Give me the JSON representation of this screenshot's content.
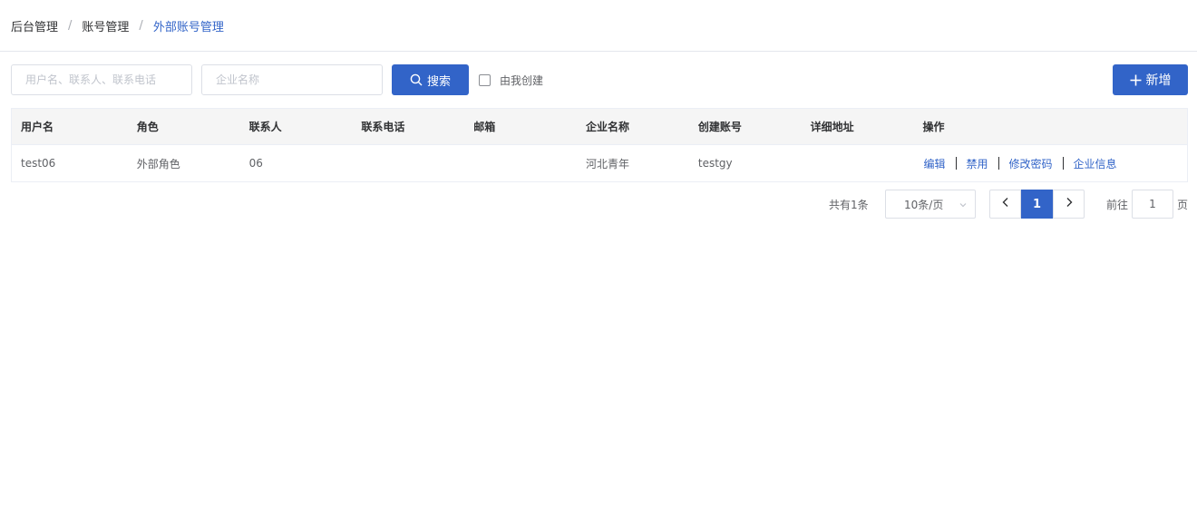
{
  "breadcrumb": {
    "items": [
      "后台管理",
      "账号管理",
      "外部账号管理"
    ],
    "separator": "/"
  },
  "search": {
    "user_placeholder": "用户名、联系人、联系电话",
    "company_placeholder": "企业名称",
    "search_label": "搜索",
    "created_by_me_label": "由我创建",
    "created_by_me_checked": false,
    "add_label": "新增"
  },
  "table": {
    "columns": [
      "用户名",
      "角色",
      "联系人",
      "联系电话",
      "邮箱",
      "企业名称",
      "创建账号",
      "详细地址",
      "操作"
    ],
    "rows": [
      {
        "username": "test06",
        "role": "外部角色",
        "contact": "06",
        "phone": "",
        "email": "",
        "company": "河北青年",
        "creator": "testgy",
        "address": "",
        "actions": [
          "编辑",
          "禁用",
          "修改密码",
          "企业信息"
        ]
      }
    ]
  },
  "pagination": {
    "total_text": "共有1条",
    "page_size": "10条/页",
    "current_page": "1",
    "goto_label": "前往",
    "goto_value": "1",
    "goto_unit": "页"
  },
  "colors": {
    "primary": "#3264c8",
    "header_bg": "#f5f5f5",
    "border": "#dcdfe6"
  },
  "icons": [
    "search-icon",
    "plus-icon",
    "chevron-left-icon",
    "chevron-right-icon",
    "chevron-down-icon"
  ]
}
